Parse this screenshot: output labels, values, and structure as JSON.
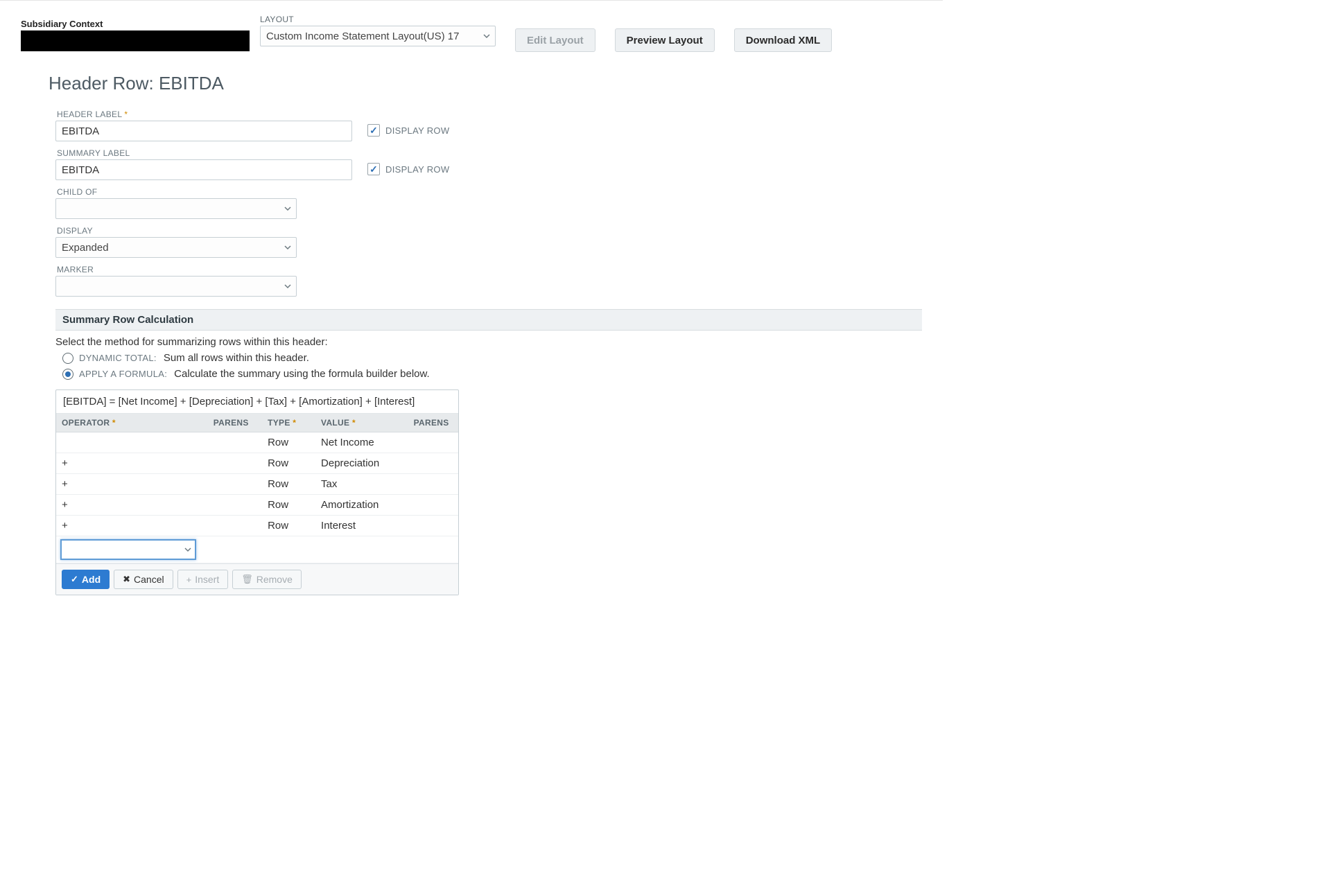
{
  "top": {
    "subsidiary_label": "Subsidiary Context",
    "layout_label": "LAYOUT",
    "layout_value": "Custom Income Statement Layout(US) 17",
    "edit_layout": "Edit Layout",
    "preview_layout": "Preview Layout",
    "download_xml": "Download XML"
  },
  "section_title": "Header Row: EBITDA",
  "form": {
    "header_label_caption": "HEADER LABEL",
    "header_label_value": "EBITDA",
    "header_display_row_label": "DISPLAY ROW",
    "header_display_row_checked": true,
    "summary_label_caption": "SUMMARY LABEL",
    "summary_label_value": "EBITDA",
    "summary_display_row_label": "DISPLAY ROW",
    "summary_display_row_checked": true,
    "child_of_caption": "CHILD OF",
    "child_of_value": "",
    "display_caption": "DISPLAY",
    "display_value": "Expanded",
    "marker_caption": "MARKER",
    "marker_value": ""
  },
  "calc": {
    "header": "Summary Row Calculation",
    "description": "Select the method for summarizing rows within this header:",
    "dynamic_total_label": "DYNAMIC TOTAL:",
    "dynamic_total_desc": "Sum all rows within this header.",
    "apply_formula_label": "APPLY A FORMULA:",
    "apply_formula_desc": "Calculate the summary using the formula builder below.",
    "selected": "apply_formula"
  },
  "formula": {
    "display_string": "[EBITDA] = [Net Income] + [Depreciation] + [Tax] + [Amortization] + [Interest]",
    "columns": {
      "operator": "OPERATOR",
      "parens1": "PARENS",
      "type": "TYPE",
      "value": "VALUE",
      "parens2": "PARENS"
    },
    "rows": [
      {
        "operator": "",
        "parens1": "",
        "type": "Row",
        "value": "Net Income",
        "parens2": ""
      },
      {
        "operator": "+",
        "parens1": "",
        "type": "Row",
        "value": "Depreciation",
        "parens2": ""
      },
      {
        "operator": "+",
        "parens1": "",
        "type": "Row",
        "value": "Tax",
        "parens2": ""
      },
      {
        "operator": "+",
        "parens1": "",
        "type": "Row",
        "value": "Amortization",
        "parens2": ""
      },
      {
        "operator": "+",
        "parens1": "",
        "type": "Row",
        "value": "Interest",
        "parens2": ""
      }
    ],
    "buttons": {
      "add": "Add",
      "cancel": "Cancel",
      "insert": "Insert",
      "remove": "Remove"
    }
  }
}
